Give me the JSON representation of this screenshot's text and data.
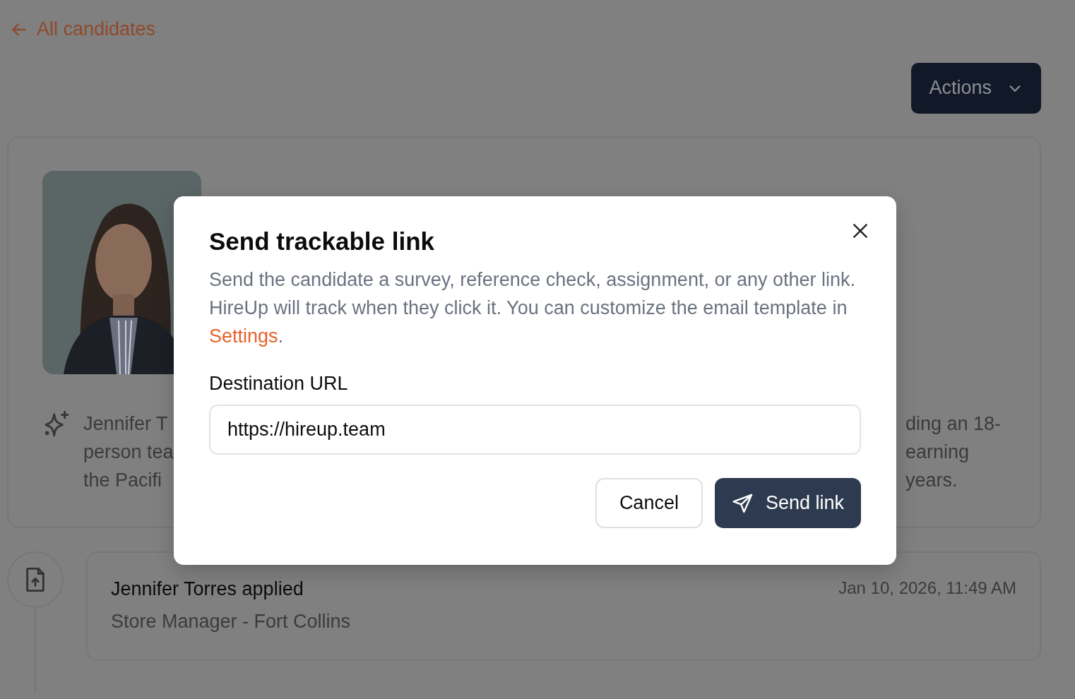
{
  "back_link": {
    "label": "All candidates"
  },
  "actions_button": {
    "label": "Actions"
  },
  "candidate_card": {
    "summary_left": [
      "Jennifer T",
      "person tea",
      "the Pacifi"
    ],
    "summary_right": [
      "ding an 18-",
      "earning",
      "years."
    ]
  },
  "timeline": [
    {
      "title": "Jennifer Torres applied",
      "subtitle": "Store Manager - Fort Collins",
      "time": "Jan 10, 2026, 11:49 AM"
    }
  ],
  "dialog": {
    "title": "Send trackable link",
    "description_before": "Send the candidate a survey, reference check, assignment, or any other link. HireUp will track when they click it. You can customize the email template in ",
    "description_link": "Settings",
    "description_after": ".",
    "field_label": "Destination URL",
    "field_value": "https://hireup.team",
    "buttons": [
      {
        "kind": "secondary",
        "label": "Cancel"
      },
      {
        "kind": "primary",
        "label": "Send link"
      }
    ]
  }
}
